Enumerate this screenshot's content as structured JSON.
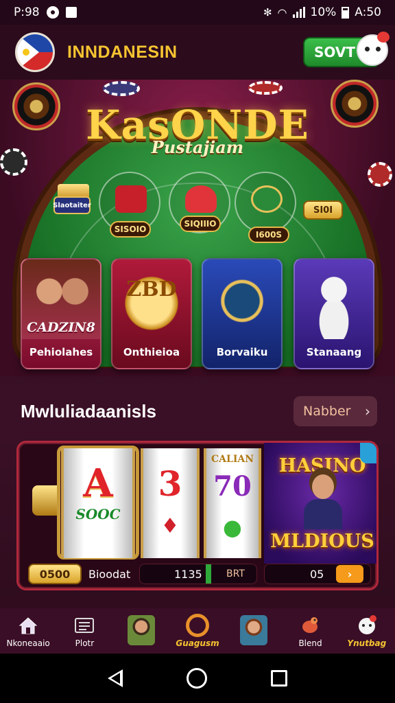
{
  "status_bar": {
    "time_left": "P:98",
    "battery_pct": "10%",
    "clock": "A:50"
  },
  "header": {
    "title": "INNDANESIN",
    "button_label": "SOVT"
  },
  "hero": {
    "title": "KasONDE",
    "subtitle": "Pustajiam",
    "badge_left": "Slaotaiter",
    "emblems": [
      {
        "label": "SISOIO"
      },
      {
        "label": "SIQIIIO"
      },
      {
        "label": "I600S"
      }
    ],
    "badge_right": "SI0I"
  },
  "categories": [
    {
      "title": "CADZIN8",
      "label": "Pehiolahes"
    },
    {
      "title": "ZBD",
      "label": "Onthieioa"
    },
    {
      "title": "",
      "label": "Borvaiku"
    },
    {
      "title": "",
      "label": "Stanaang"
    }
  ],
  "section": {
    "title": "Mwluliadaanisls",
    "button_label": "Nabber"
  },
  "games": {
    "reels": [
      {
        "main": "A",
        "sub": "SOOC"
      },
      {
        "main": "3",
        "sub": ""
      },
      {
        "main": "70",
        "sub": "CALIAN"
      }
    ],
    "promo_title": "HASINO",
    "promo_subtitle": "MLDIOUS",
    "pill_gold": "0500",
    "pill_text": "Bioodat",
    "pill_value": "1135",
    "pill_tail": "BRT",
    "pill_value2": "05",
    "play_icon": "chevron-right-icon"
  },
  "bottom_nav": [
    {
      "label": "Nkoneaaio",
      "icon": "home-icon"
    },
    {
      "label": "Plotr",
      "icon": "list-icon"
    },
    {
      "label": "",
      "icon": "avatar-icon"
    },
    {
      "label": "Guagusm",
      "icon": "ring-icon"
    },
    {
      "label": "",
      "icon": "avatar-icon"
    },
    {
      "label": "Blend",
      "icon": "bird-icon"
    },
    {
      "label": "Ynutbag",
      "icon": "mascot-icon"
    }
  ],
  "colors": {
    "accent_gold": "#f6c431",
    "background": "#2b0c1d",
    "green_button": "#2fa83a"
  }
}
